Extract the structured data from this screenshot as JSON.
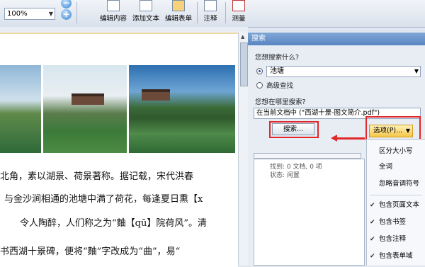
{
  "toolbar": {
    "zoom_value": "100%",
    "zoom_in_icon": "plus-icon",
    "zoom_out_icon": "minus-icon",
    "edit_content": "编辑内容",
    "add_text": "添加文本",
    "edit_form": "编辑表单",
    "annotate": "注释",
    "measure": "测量"
  },
  "document": {
    "lines": [
      "北角，素以湖景、荷景著称。据记载，宋代洪春",
      "与金沙涧相通的池塘中满了荷花，每逢夏日熏【x",
      "令人陶醉，人们称之为“麯【qū】院荷风”。清",
      "书西湖十景碑，便将“麯”字改成为“曲”，易“"
    ]
  },
  "search_panel": {
    "title": "搜索",
    "question_what": "您想搜索什么?",
    "search_term": "池塘",
    "advanced_search": "高级查找",
    "question_where": "您想在哪里搜索?",
    "scope": "在当前文档中 (\"西湖十景-图文简介.pdf\")",
    "search_button": "搜索...",
    "options_button": "选项(P)...",
    "found_text": "找到: 0 文档, 0 项",
    "status_text": "状态: 闲置",
    "highlight_color": "#e0282a"
  },
  "options_menu": {
    "items": [
      {
        "label": "区分大小写",
        "checked": false
      },
      {
        "label": "全词",
        "checked": false
      },
      {
        "label": "忽略音调符号",
        "checked": false
      },
      {
        "label": "包含页面文本",
        "checked": true
      },
      {
        "label": "包含书签",
        "checked": true
      },
      {
        "label": "包含注释",
        "checked": true
      },
      {
        "label": "包含表单域",
        "checked": true
      }
    ]
  }
}
